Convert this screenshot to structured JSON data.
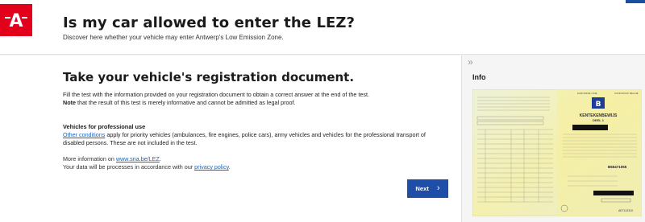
{
  "header": {
    "title": "Is my car allowed to enter the LEZ?",
    "subtitle": "Discover here whether your vehicle may enter Antwerp's Low Emission Zone.",
    "logo_letter": "A",
    "brand_color": "#e3001b",
    "accent_color": "#1a4fa0"
  },
  "main": {
    "title": "Take your vehicle's registration document.",
    "intro_line1": "Fill the test with the information provided on your registration document to obtain a correct answer at the end of the test.",
    "intro_note_label": "Note",
    "intro_note_text": " that the result of this test is merely informative and cannot be admitted as legal proof.",
    "pro_title": "Vehicles for professional use",
    "pro_link": "Other conditions",
    "pro_text": " apply for priority vehicles (ambulances, fire engines, police cars), army vehicles and vehicles for the professional transport of disabled persons. These are not included in the test.",
    "more_prefix": "More information on ",
    "more_link": "www.sna.be/LEZ",
    "more_suffix": ".",
    "privacy_prefix": "Your data will be processes in accordance with our ",
    "privacy_link": "privacy policy",
    "privacy_suffix": ".",
    "next_label": "Next",
    "next_icon": "chevron-right-icon",
    "button_color": "#1f4ea8",
    "link_color": "#1e63b8"
  },
  "sidebar": {
    "collapse_icon": "double-chevron-right-icon",
    "title": "Info",
    "document_image": {
      "header_left": "EUROPESE UNIE",
      "header_right": "KONINKRIJK BELGIË",
      "country_code": "B",
      "doc_title": "KENTEKENBEWIJS",
      "doc_part": "DEEL 1",
      "number": "B65471055",
      "serial": "AE7112310"
    }
  }
}
